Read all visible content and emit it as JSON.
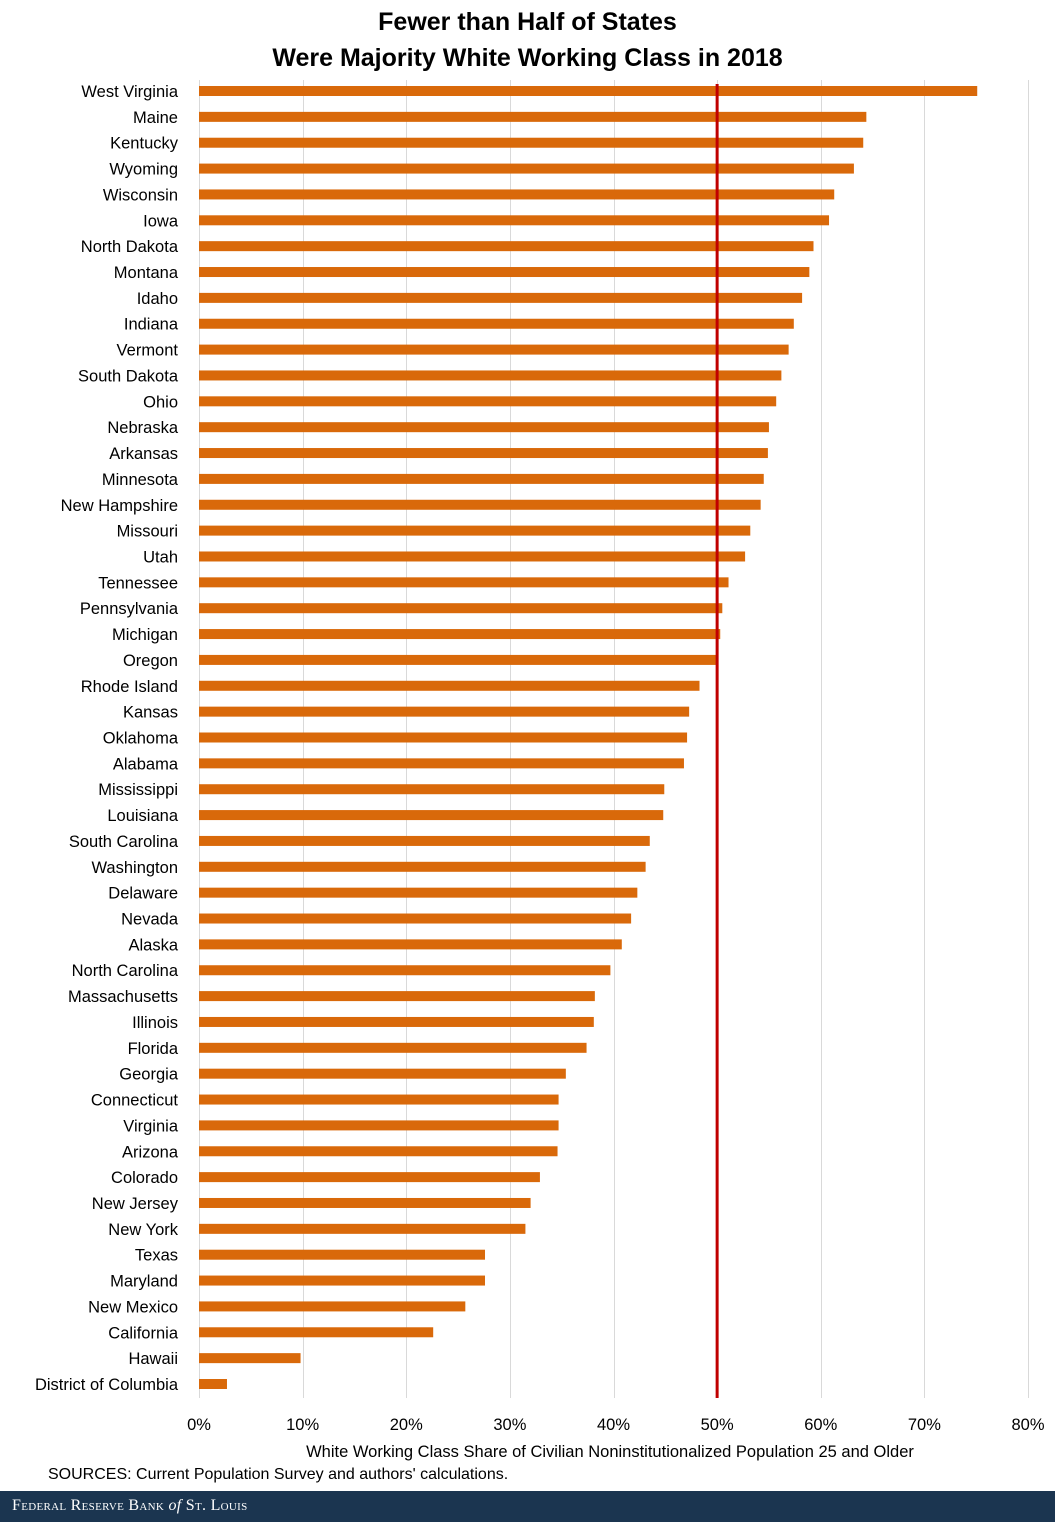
{
  "chart_data": {
    "type": "bar",
    "orientation": "horizontal",
    "title": "Fewer than Half of States Were Majority White Working Class in 2018",
    "title_lines": [
      "Fewer than Half of States",
      "Were Majority White Working Class in 2018"
    ],
    "xlabel": "White Working Class Share of Civilian Noninstitutionalized Population 25 and Older",
    "ylabel": "",
    "xlim": [
      0,
      80
    ],
    "xticks": [
      0,
      10,
      20,
      30,
      40,
      50,
      60,
      70,
      80
    ],
    "xtick_labels": [
      "0%",
      "10%",
      "20%",
      "30%",
      "40%",
      "50%",
      "60%",
      "70%",
      "80%"
    ],
    "grid": "vertical",
    "reference_line": {
      "value": 50,
      "color": "#c00000"
    },
    "bar_color": "#d9690a",
    "categories": [
      "West Virginia",
      "Maine",
      "Kentucky",
      "Wyoming",
      "Wisconsin",
      "Iowa",
      "North Dakota",
      "Montana",
      "Idaho",
      "Indiana",
      "Vermont",
      "South Dakota",
      "Ohio",
      "Nebraska",
      "Arkansas",
      "Minnesota",
      "New Hampshire",
      "Missouri",
      "Utah",
      "Tennessee",
      "Pennsylvania",
      "Michigan",
      "Oregon",
      "Rhode Island",
      "Kansas",
      "Oklahoma",
      "Alabama",
      "Mississippi",
      "Louisiana",
      "South Carolina",
      "Washington",
      "Delaware",
      "Nevada",
      "Alaska",
      "North Carolina",
      "Massachusetts",
      "Illinois",
      "Florida",
      "Georgia",
      "Connecticut",
      "Virginia",
      "Arizona",
      "Colorado",
      "New Jersey",
      "New York",
      "Texas",
      "Maryland",
      "New Mexico",
      "California",
      "Hawaii",
      "District of Columbia"
    ],
    "values": [
      75.1,
      64.4,
      64.1,
      63.2,
      61.3,
      60.8,
      59.3,
      58.9,
      58.2,
      57.4,
      56.9,
      56.2,
      55.7,
      55.0,
      54.9,
      54.5,
      54.2,
      53.2,
      52.7,
      51.1,
      50.5,
      50.3,
      49.9,
      48.3,
      47.3,
      47.1,
      46.8,
      44.9,
      44.8,
      43.5,
      43.1,
      42.3,
      41.7,
      40.8,
      39.7,
      38.2,
      38.1,
      37.4,
      35.4,
      34.7,
      34.7,
      34.6,
      32.9,
      32.0,
      31.5,
      27.6,
      27.6,
      25.7,
      22.6,
      9.8,
      2.7
    ],
    "value_unit": "percent"
  },
  "sources": "SOURCES: Current  Population Survey and authors' calculations.",
  "footer": {
    "part1": "Federal Reserve Bank ",
    "of": "of",
    "part2": " St. Louis"
  }
}
